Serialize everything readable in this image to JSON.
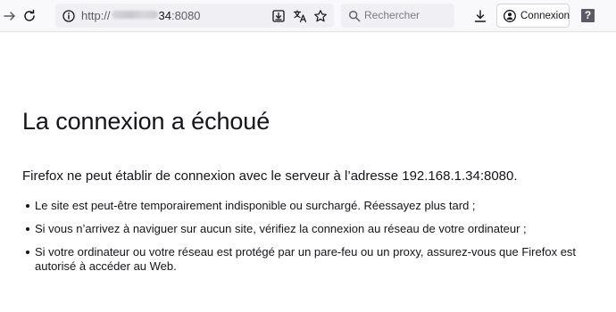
{
  "browser": {
    "url": {
      "prefix": "http://",
      "host_suffix": "34",
      "port": ":8080"
    },
    "search": {
      "placeholder": "Rechercher"
    },
    "account_button_label": "Connexion",
    "icons": {
      "forward": "forward-icon",
      "reload": "reload-icon",
      "page_info": "info-icon",
      "save_page": "save-page-icon",
      "translate": "translate-icon",
      "bookmark": "bookmark-star-icon",
      "search": "search-icon",
      "downloads": "download-icon",
      "account": "account-icon",
      "help": "help-icon"
    }
  },
  "error_page": {
    "title": "La connexion a échoué",
    "message": "Firefox ne peut établir de connexion avec le serveur à l’adresse 192.168.1.34:8080.",
    "suggestions": [
      "Le site est peut-être temporairement indisponible ou surchargé. Réessayez plus tard ;",
      "Si vous n’arrivez à naviguer sur aucun site, vérifiez la connexion au réseau de votre ordinateur ;",
      "Si votre ordinateur ou votre réseau est protégé par un pare-feu ou un proxy, assurez-vous que Firefox est autorisé à accéder au Web."
    ]
  }
}
